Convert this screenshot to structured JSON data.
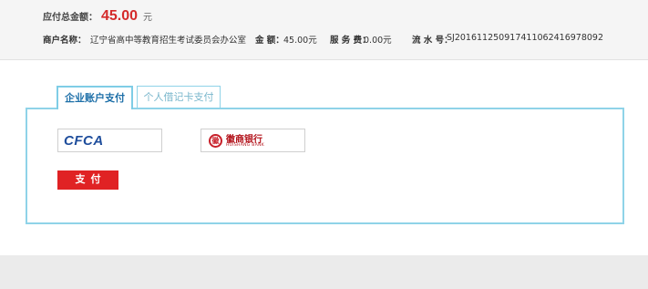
{
  "summary": {
    "total_label": "应付总金额：",
    "total_amount": "45.00",
    "total_unit": "元",
    "merchant_label": "商户名称：",
    "merchant_value": "辽宁省高中等教育招生考试委员会办公室",
    "amount_label": "金 额：",
    "amount_value": "45.00元",
    "fee_label": "服 务 费：",
    "fee_value": "0.00元",
    "serial_label": "流 水 号：",
    "serial_value": "SJ20161125091741106241697809​2"
  },
  "tabs": [
    {
      "label": "企业账户支付",
      "active": true
    },
    {
      "label": "个人借记卡支付",
      "active": false
    }
  ],
  "banks": {
    "cfca_logo": "CFCA",
    "hsb_mark": "徽",
    "hsb_name": "徽商银行",
    "hsb_sub": "HUISHANG BANK"
  },
  "pay_button": "支付",
  "colors": {
    "accent": "#8fd3e8",
    "amount_red": "#d42a2a",
    "button_red": "#e02224",
    "tab_active_text": "#1d6fa8"
  }
}
